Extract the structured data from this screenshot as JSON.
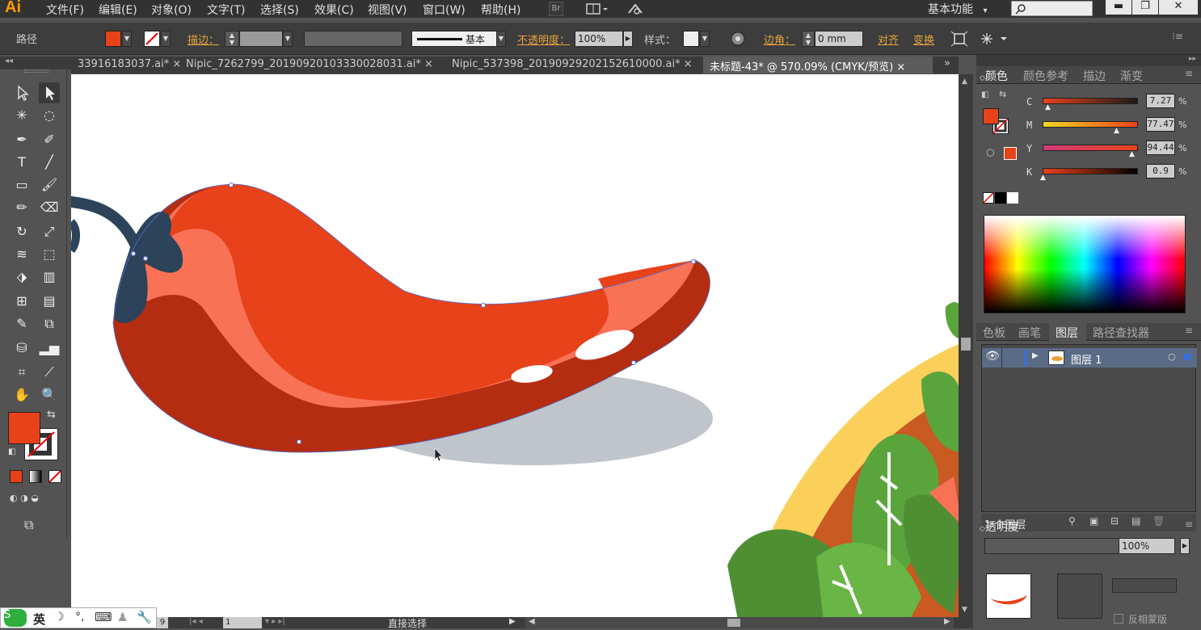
{
  "app": {
    "logo": "Ai"
  },
  "menu": [
    "文件(F)",
    "编辑(E)",
    "对象(O)",
    "文字(T)",
    "选择(S)",
    "效果(C)",
    "视图(V)",
    "窗口(W)",
    "帮助(H)"
  ],
  "menubar_buttons": {
    "bridge": "Br"
  },
  "workspace": {
    "label": "基本功能",
    "chevron": "▾"
  },
  "window_buttons": {
    "minimize": "▬",
    "restore": "❐",
    "close": "✕"
  },
  "control": {
    "selection_label": "路径",
    "fill_color": "#e8421a",
    "stroke_label": "描边：",
    "stroke_style": "基本",
    "opacity_label": "不透明度：",
    "opacity_value": "100%",
    "style_label": "样式：",
    "corner_label": "边角：",
    "corner_value": "0 mm",
    "align_label": "对齐",
    "transform_label": "变换"
  },
  "tabs": [
    {
      "label": "33916183037.ai*",
      "close": "×"
    },
    {
      "label": "Nipic_7262799_20190920103330028031.ai*",
      "close": "×"
    },
    {
      "label": "Nipic_537398_20190929202152610000.ai*",
      "close": "×"
    },
    {
      "label": "未标题-43* @ 570.09% (CMYK/预览)",
      "close": "×",
      "active": true
    }
  ],
  "status": {
    "zoom": "9",
    "artboard": "1",
    "tool_name": "直接选择"
  },
  "color_panel": {
    "tabs": [
      "颜色",
      "颜色参考",
      "描边",
      "渐变"
    ],
    "active_tab": "颜色",
    "fill": "#e8421a",
    "channels": [
      {
        "label": "C",
        "value": "7.27",
        "pct": "%",
        "level": 0.0727
      },
      {
        "label": "M",
        "value": "77.47",
        "pct": "%",
        "level": 0.7747
      },
      {
        "label": "Y",
        "value": "94.44",
        "pct": "%",
        "level": 0.9444
      },
      {
        "label": "K",
        "value": "0.9",
        "pct": "%",
        "level": 0.009
      }
    ]
  },
  "layers_panel": {
    "tabs": [
      "色板",
      "画笔",
      "图层",
      "路径查找器"
    ],
    "active_tab": "图层",
    "layers": [
      {
        "name": "图层 1"
      }
    ],
    "footer_count": "1 个图层"
  },
  "transparency_panel": {
    "title": "透明度",
    "opacity": "100%",
    "invert_mask_label": "反相蒙版"
  },
  "ime": {
    "lang": "英"
  },
  "colors": {
    "pepper_body": "#e8421a",
    "pepper_dark": "#b52d10",
    "pepper_highlight": "#f97256",
    "stem": "#2c435a",
    "shadow": "#c0c5cb",
    "leaf_green": "#5aa43c",
    "bowl_yellow": "#fad05a",
    "bowl_brown": "#c85a22"
  }
}
